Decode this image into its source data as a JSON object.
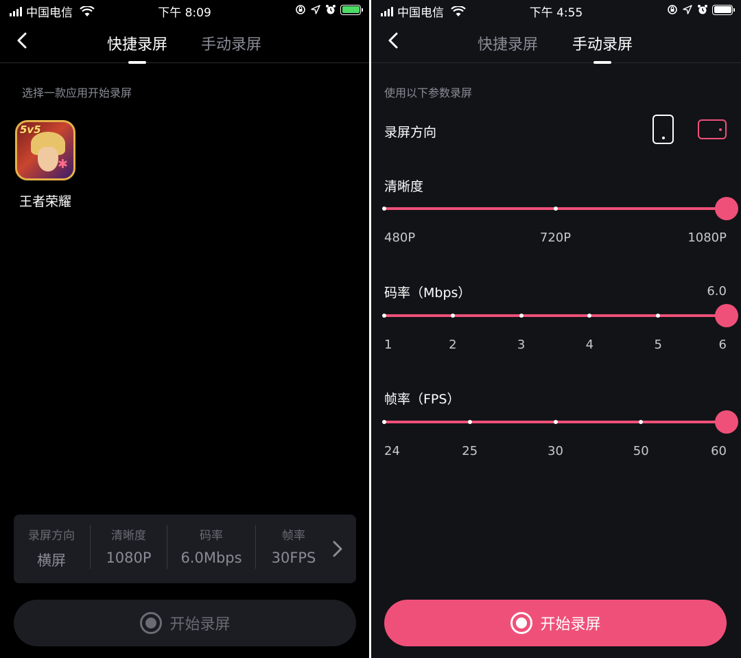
{
  "left": {
    "status": {
      "carrier": "中国电信",
      "time": "下午 8:09"
    },
    "tabs": [
      {
        "label": "快捷录屏",
        "active": true
      },
      {
        "label": "手动录屏",
        "active": false
      }
    ],
    "section_label": "选择一款应用开始录屏",
    "app": {
      "name": "王者荣耀",
      "badge": "5v5"
    },
    "settings": [
      {
        "key": "录屏方向",
        "value": "横屏"
      },
      {
        "key": "清晰度",
        "value": "1080P"
      },
      {
        "key": "码率",
        "value": "6.0Mbps"
      },
      {
        "key": "帧率",
        "value": "30FPS"
      }
    ],
    "start_label": "开始录屏"
  },
  "right": {
    "status": {
      "carrier": "中国电信",
      "time": "下午 4:55"
    },
    "tabs": [
      {
        "label": "快捷录屏",
        "active": false
      },
      {
        "label": "手动录屏",
        "active": true
      }
    ],
    "section_label": "使用以下参数录屏",
    "orientation": {
      "label": "录屏方向",
      "selected": "landscape"
    },
    "resolution": {
      "label": "清晰度",
      "ticks": [
        "480P",
        "720P",
        "1080P"
      ],
      "selected_index": 2
    },
    "bitrate": {
      "label": "码率（Mbps）",
      "value": "6.0",
      "ticks": [
        "1",
        "2",
        "3",
        "4",
        "5",
        "6"
      ],
      "selected_index": 5
    },
    "framerate": {
      "label": "帧率（FPS）",
      "ticks": [
        "24",
        "25",
        "30",
        "50",
        "60"
      ],
      "selected_index": 4
    },
    "start_label": "开始录屏"
  },
  "colors": {
    "accent": "#ef5079",
    "bg_left": "#000000",
    "bg_right": "#121317",
    "card": "#1c1d22"
  }
}
